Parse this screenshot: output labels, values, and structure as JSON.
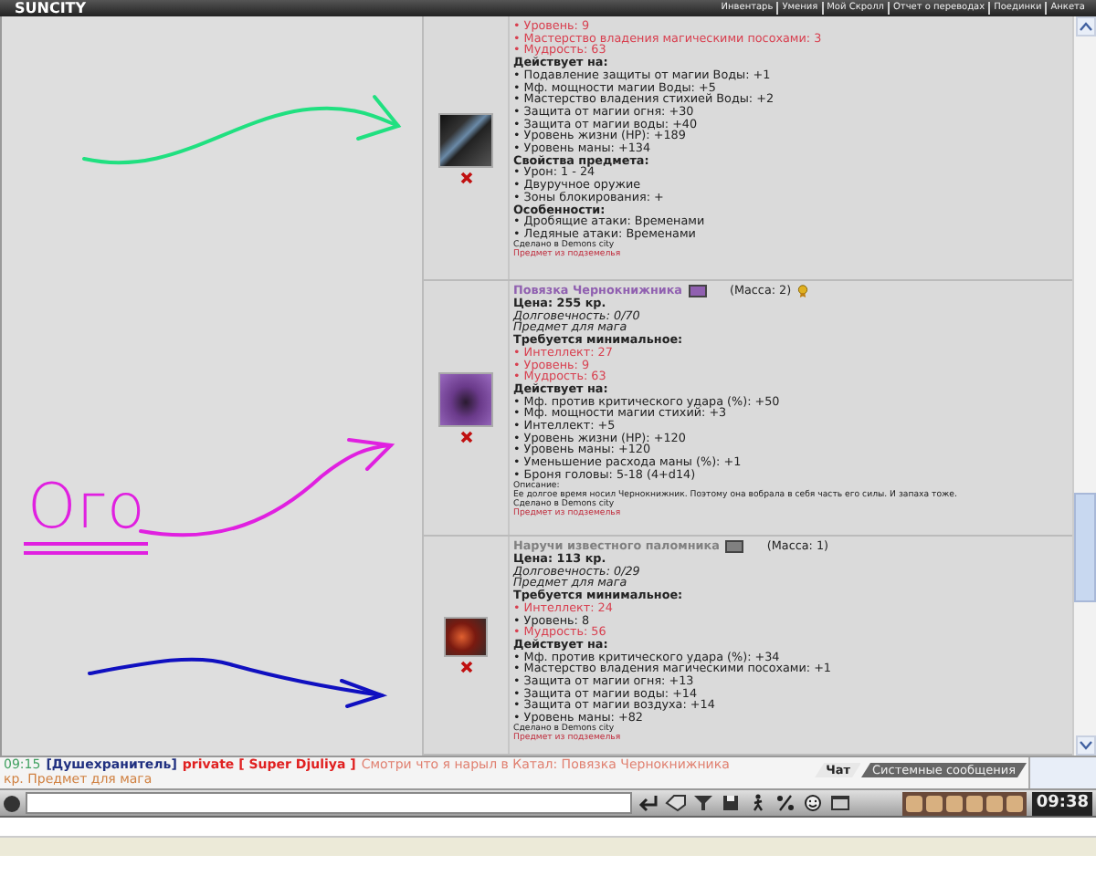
{
  "header": {
    "logo": "SUNCITY",
    "links": [
      "Инвентарь",
      "Умения",
      "Мой Скролл",
      "Отчет о переводах",
      "Поединки",
      "Анкета"
    ]
  },
  "annotation": {
    "text": "Ого"
  },
  "items": [
    {
      "kind": "staff",
      "lines": [
        {
          "kind": "bullet",
          "text": "• Уровень: 9",
          "unmet": true
        },
        {
          "kind": "bullet",
          "text": "• Мастерство владения магическими посохами: 3",
          "unmet": true
        },
        {
          "kind": "bullet",
          "text": "• Мудрость: 63",
          "unmet": true
        },
        {
          "kind": "heading",
          "text": "Действует на:"
        },
        {
          "kind": "bullet",
          "text": "• Подавление защиты от магии Воды: +1",
          "unmet": false
        },
        {
          "kind": "bullet",
          "text": "• Мф. мощности магии Воды: +5",
          "unmet": false
        },
        {
          "kind": "bullet",
          "text": "• Мастерство владения стихией Воды: +2",
          "unmet": false
        },
        {
          "kind": "bullet",
          "text": "• Защита от магии огня: +30",
          "unmet": false
        },
        {
          "kind": "bullet",
          "text": "• Защита от магии воды: +40",
          "unmet": false
        },
        {
          "kind": "bullet",
          "text": "• Уровень жизни (HP): +189",
          "unmet": false
        },
        {
          "kind": "bullet",
          "text": "• Уровень маны: +134",
          "unmet": false
        },
        {
          "kind": "heading",
          "text": "Свойства предмета:"
        },
        {
          "kind": "bullet",
          "text": "• Урон: 1 - 24",
          "unmet": false
        },
        {
          "kind": "bullet",
          "text": "• Двуручное оружие",
          "unmet": false
        },
        {
          "kind": "bullet",
          "text": "• Зоны блокирования: +",
          "unmet": false
        },
        {
          "kind": "heading",
          "text": "Особенности:"
        },
        {
          "kind": "bullet",
          "text": "• Дробящие атаки: Временами",
          "unmet": false
        },
        {
          "kind": "bullet",
          "text": "• Ледяные атаки: Временами",
          "unmet": false
        },
        {
          "kind": "small",
          "text": "Сделано в Demons city"
        },
        {
          "kind": "gift",
          "text": "Предмет из подземелья"
        }
      ]
    },
    {
      "kind": "headband",
      "lines": [
        {
          "kind": "title",
          "text": "Повязка Чернокнижника",
          "mass": "(Масса: 2)",
          "color": "#9060b0",
          "award": true
        },
        {
          "kind": "price",
          "text": "Цена: 255 кр."
        },
        {
          "kind": "italic",
          "text": "Долговечность: 0/70"
        },
        {
          "kind": "italic",
          "text": "Предмет для мага"
        },
        {
          "kind": "heading",
          "text": "Требуется минимальное:"
        },
        {
          "kind": "bullet",
          "text": "• Интеллект: 27",
          "unmet": true
        },
        {
          "kind": "bullet",
          "text": "• Уровень: 9",
          "unmet": true
        },
        {
          "kind": "bullet",
          "text": "• Мудрость: 63",
          "unmet": true
        },
        {
          "kind": "heading",
          "text": "Действует на:"
        },
        {
          "kind": "bullet",
          "text": "• Мф. против критического удара (%): +50",
          "unmet": false
        },
        {
          "kind": "bullet",
          "text": "• Мф. мощности магии стихий: +3",
          "unmet": false
        },
        {
          "kind": "bullet",
          "text": "• Интеллект: +5",
          "unmet": false
        },
        {
          "kind": "bullet",
          "text": "• Уровень жизни (HP): +120",
          "unmet": false
        },
        {
          "kind": "bullet",
          "text": "• Уровень маны: +120",
          "unmet": false
        },
        {
          "kind": "bullet",
          "text": "• Уменьшение расхода маны (%): +1",
          "unmet": false
        },
        {
          "kind": "bullet",
          "text": "• Броня головы: 5-18 (4+d14)",
          "unmet": false
        },
        {
          "kind": "small",
          "text": "Описание:"
        },
        {
          "kind": "small",
          "text": "Ее долгое время носил Чернокнижник. Поэтому она вобрала в себя часть его силы. И запаха тоже."
        },
        {
          "kind": "small",
          "text": "Сделано в Demons city"
        },
        {
          "kind": "gift",
          "text": "Предмет из подземелья"
        }
      ]
    },
    {
      "kind": "bracers",
      "lines": [
        {
          "kind": "title",
          "text": "Наручи известного паломника",
          "mass": "(Масса: 1)",
          "color": "#808080",
          "award": false
        },
        {
          "kind": "price",
          "text": "Цена: 113 кр."
        },
        {
          "kind": "italic",
          "text": "Долговечность: 0/29"
        },
        {
          "kind": "italic",
          "text": "Предмет для мага"
        },
        {
          "kind": "heading",
          "text": "Требуется минимальное:"
        },
        {
          "kind": "bullet",
          "text": "• Интеллект: 24",
          "unmet": true
        },
        {
          "kind": "bullet",
          "text": "• Уровень: 8",
          "unmet": false
        },
        {
          "kind": "bullet",
          "text": "• Мудрость: 56",
          "unmet": true
        },
        {
          "kind": "heading",
          "text": "Действует на:"
        },
        {
          "kind": "bullet",
          "text": "• Мф. против критического удара (%): +34",
          "unmet": false
        },
        {
          "kind": "bullet",
          "text": "• Мастерство владения магическими посохами: +1",
          "unmet": false
        },
        {
          "kind": "bullet",
          "text": "• Защита от магии огня: +13",
          "unmet": false
        },
        {
          "kind": "bullet",
          "text": "• Защита от магии воды: +14",
          "unmet": false
        },
        {
          "kind": "bullet",
          "text": "• Защита от магии воздуха: +14",
          "unmet": false
        },
        {
          "kind": "bullet",
          "text": "• Уровень маны: +82",
          "unmet": false
        },
        {
          "kind": "small",
          "text": "Сделано в Demons city"
        },
        {
          "kind": "gift",
          "text": "Предмет из подземелья"
        }
      ]
    }
  ],
  "chat": {
    "time": "09:15",
    "sender": "[Душехранитель]",
    "recipient": "private [ Super Djuliya ]",
    "message": "Смотри что я нарыл в Катал: Повязка Чернокнижника",
    "message_end": "кр. Предмет для мага",
    "tabs": [
      {
        "label": "Чат",
        "selected": true
      },
      {
        "label": "Системные сообщения",
        "selected": false
      }
    ]
  },
  "clock": "09:38"
}
